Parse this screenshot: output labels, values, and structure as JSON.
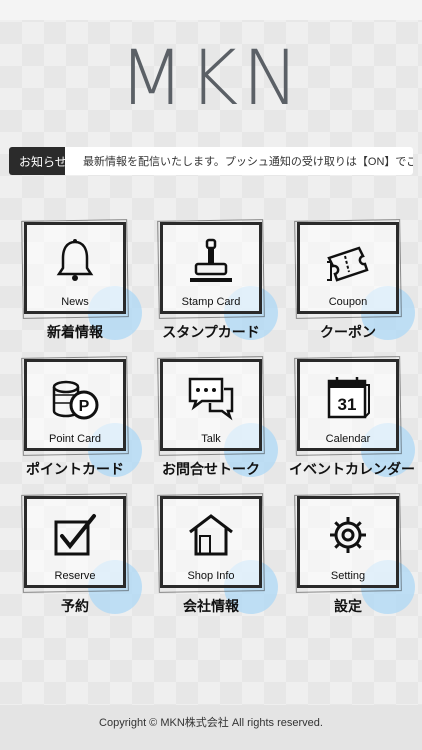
{
  "app": {
    "logo": "MKN"
  },
  "news": {
    "label": "お知らせ",
    "text": "最新情報を配信いたします。プッシュ通知の受け取りは【ON】でご設定"
  },
  "menu": [
    {
      "en": "News",
      "jp": "新着情報",
      "icon": "bell-icon"
    },
    {
      "en": "Stamp Card",
      "jp": "スタンプカード",
      "icon": "stamp-icon"
    },
    {
      "en": "Coupon",
      "jp": "クーポン",
      "icon": "ticket-icon"
    },
    {
      "en": "Point Card",
      "jp": "ポイントカード",
      "icon": "coins-icon"
    },
    {
      "en": "Talk",
      "jp": "お問合せトーク",
      "icon": "chat-icon"
    },
    {
      "en": "Calendar",
      "jp": "イベントカレンダー",
      "icon": "calendar-icon",
      "calendar_day": "31"
    },
    {
      "en": "Reserve",
      "jp": "予約",
      "icon": "checkbox-icon"
    },
    {
      "en": "Shop Info",
      "jp": "会社情報",
      "icon": "house-icon"
    },
    {
      "en": "Setting",
      "jp": "設定",
      "icon": "gear-icon"
    }
  ],
  "footer": {
    "copyright": "Copyright © MKN株式会社 All rights reserved."
  },
  "colors": {
    "bubble": "#add8f5",
    "frame": "#2a2a2a",
    "news_label_bg": "#2b2b2b"
  }
}
